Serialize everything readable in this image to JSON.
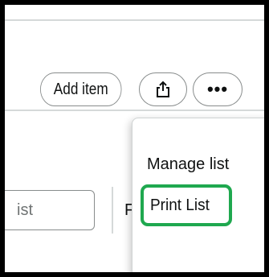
{
  "toolbar": {
    "add_item_label": "Add item",
    "share_icon": "share-upload-icon",
    "more_label": "•••"
  },
  "search": {
    "placeholder_fragment": "ist"
  },
  "filter": {
    "label_fragment": "F"
  },
  "menu": {
    "items": [
      {
        "label": "Manage list"
      },
      {
        "label": "Print List",
        "highlighted": true
      }
    ]
  },
  "colors": {
    "highlight": "#1fa84f",
    "border": "#888c8c",
    "text": "#0f1111",
    "frame": "#000000"
  }
}
